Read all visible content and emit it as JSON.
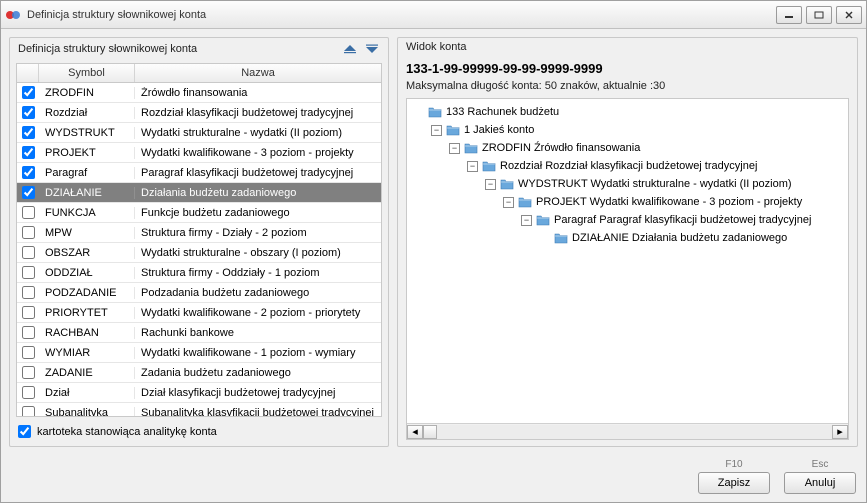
{
  "window": {
    "title": "Definicja struktury słownikowej konta"
  },
  "left": {
    "title": "Definicja struktury słownikowej konta",
    "columns": {
      "symbol": "Symbol",
      "nazwa": "Nazwa"
    },
    "rows": [
      {
        "checked": true,
        "symbol": "ZRODFIN",
        "nazwa": "Źrówdło finansowania",
        "selected": false
      },
      {
        "checked": true,
        "symbol": "Rozdział",
        "nazwa": "Rozdział klasyfikacji budżetowej tradycyjnej",
        "selected": false
      },
      {
        "checked": true,
        "symbol": "WYDSTRUKT",
        "nazwa": "Wydatki strukturalne - wydatki (II poziom)",
        "selected": false
      },
      {
        "checked": true,
        "symbol": "PROJEKT",
        "nazwa": "Wydatki kwalifikowane - 3 poziom - projekty",
        "selected": false
      },
      {
        "checked": true,
        "symbol": "Paragraf",
        "nazwa": "Paragraf klasyfikacji budżetowej tradycyjnej",
        "selected": false
      },
      {
        "checked": true,
        "symbol": "DZIAŁANIE",
        "nazwa": "Działania budżetu zadaniowego",
        "selected": true
      },
      {
        "checked": false,
        "symbol": "FUNKCJA",
        "nazwa": "Funkcje budżetu zadaniowego",
        "selected": false
      },
      {
        "checked": false,
        "symbol": "MPW",
        "nazwa": "Struktura firmy - Działy - 2 poziom",
        "selected": false
      },
      {
        "checked": false,
        "symbol": "OBSZAR",
        "nazwa": "Wydatki strukturalne - obszary (I poziom)",
        "selected": false
      },
      {
        "checked": false,
        "symbol": "ODDZIAŁ",
        "nazwa": "Struktura firmy - Oddziały - 1 poziom",
        "selected": false
      },
      {
        "checked": false,
        "symbol": "PODZADANIE",
        "nazwa": "Podzadania budżetu zadaniowego",
        "selected": false
      },
      {
        "checked": false,
        "symbol": "PRIORYTET",
        "nazwa": "Wydatki kwalifikowane - 2 poziom - priorytety",
        "selected": false
      },
      {
        "checked": false,
        "symbol": "RACHBAN",
        "nazwa": "Rachunki bankowe",
        "selected": false
      },
      {
        "checked": false,
        "symbol": "WYMIAR",
        "nazwa": "Wydatki kwalifikowane - 1 poziom - wymiary",
        "selected": false
      },
      {
        "checked": false,
        "symbol": "ZADANIE",
        "nazwa": "Zadania budżetu zadaniowego",
        "selected": false
      },
      {
        "checked": false,
        "symbol": "Dział",
        "nazwa": "Dział klasyfikacji budżetowej tradycyjnej",
        "selected": false
      },
      {
        "checked": false,
        "symbol": "Subanalityka",
        "nazwa": "Subanalityka klasyfikacji budżetowej tradycyjnej",
        "selected": false
      }
    ],
    "footer": {
      "checkbox_checked": true,
      "checkbox_label": "kartoteka stanowiąca analitykę konta"
    }
  },
  "right": {
    "title": "Widok konta",
    "code": "133-1-99-99999-99-99-9999-9999",
    "length_line": "Maksymalna długość konta: 50 znaków, aktualnie :30",
    "tree": [
      {
        "depth": 0,
        "toggle": "",
        "label": "133 Rachunek budżetu"
      },
      {
        "depth": 1,
        "toggle": "-",
        "label": "1 Jakieś konto"
      },
      {
        "depth": 2,
        "toggle": "-",
        "label": "ZRODFIN Źrówdło finansowania"
      },
      {
        "depth": 3,
        "toggle": "-",
        "label": "Rozdział Rozdział klasyfikacji budżetowej tradycyjnej"
      },
      {
        "depth": 4,
        "toggle": "-",
        "label": "WYDSTRUKT Wydatki strukturalne - wydatki (II poziom)"
      },
      {
        "depth": 5,
        "toggle": "-",
        "label": "PROJEKT Wydatki kwalifikowane - 3 poziom - projekty"
      },
      {
        "depth": 6,
        "toggle": "-",
        "label": "Paragraf Paragraf klasyfikacji budżetowej tradycyjnej"
      },
      {
        "depth": 7,
        "toggle": "",
        "label": "DZIAŁANIE Działania budżetu zadaniowego"
      }
    ]
  },
  "buttons": {
    "save": {
      "hint": "F10",
      "label": "Zapisz"
    },
    "cancel": {
      "hint": "Esc",
      "label": "Anuluj"
    }
  },
  "icons": {
    "up": "▲",
    "down": "▼",
    "minus": "−",
    "folder_color": "#6aa8dc"
  }
}
